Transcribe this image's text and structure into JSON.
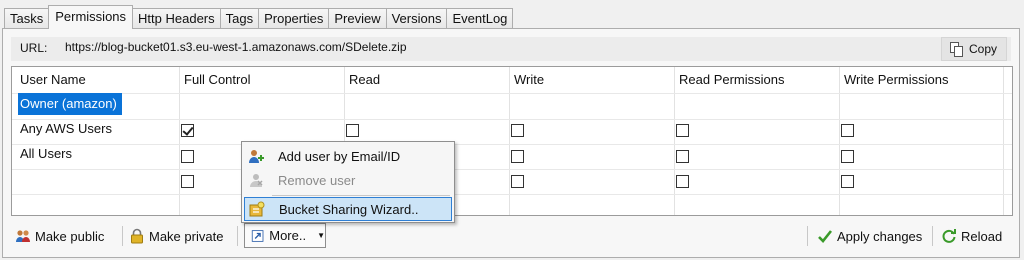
{
  "tabs": [
    "Tasks",
    "Permissions",
    "Http Headers",
    "Tags",
    "Properties",
    "Preview",
    "Versions",
    "EventLog"
  ],
  "active_tab": "Permissions",
  "url": {
    "label": "URL:",
    "value": "https://blog-bucket01.s3.eu-west-1.amazonaws.com/SDelete.zip",
    "copy_label": "Copy"
  },
  "grid": {
    "columns": [
      "User Name",
      "Full Control",
      "Read",
      "Write",
      "Read Permissions",
      "Write Permissions"
    ],
    "rows": [
      {
        "user": "Owner (amazon)",
        "selected": true,
        "checks": [
          true,
          false,
          false,
          false,
          false
        ]
      },
      {
        "user": "Any AWS Users",
        "selected": false,
        "checks": [
          false,
          false,
          false,
          false,
          false
        ]
      },
      {
        "user": "All Users",
        "selected": false,
        "checks": [
          false,
          false,
          false,
          false,
          false
        ]
      }
    ]
  },
  "context_menu": {
    "items": [
      {
        "label": "Add user by Email/ID",
        "icon": "add-user-icon",
        "enabled": true
      },
      {
        "label": "Remove user",
        "icon": "remove-user-icon",
        "enabled": false
      },
      {
        "label": "Bucket Sharing Wizard..",
        "icon": "wizard-icon",
        "enabled": true,
        "highlighted": true
      }
    ]
  },
  "toolbar": {
    "make_public": "Make public",
    "make_private": "Make private",
    "more": "More..",
    "apply_changes": "Apply changes",
    "reload": "Reload"
  },
  "colors": {
    "selection": "#0a73d8",
    "menu_highlight": "#cce4f7",
    "menu_highlight_border": "#2f7fd4"
  }
}
